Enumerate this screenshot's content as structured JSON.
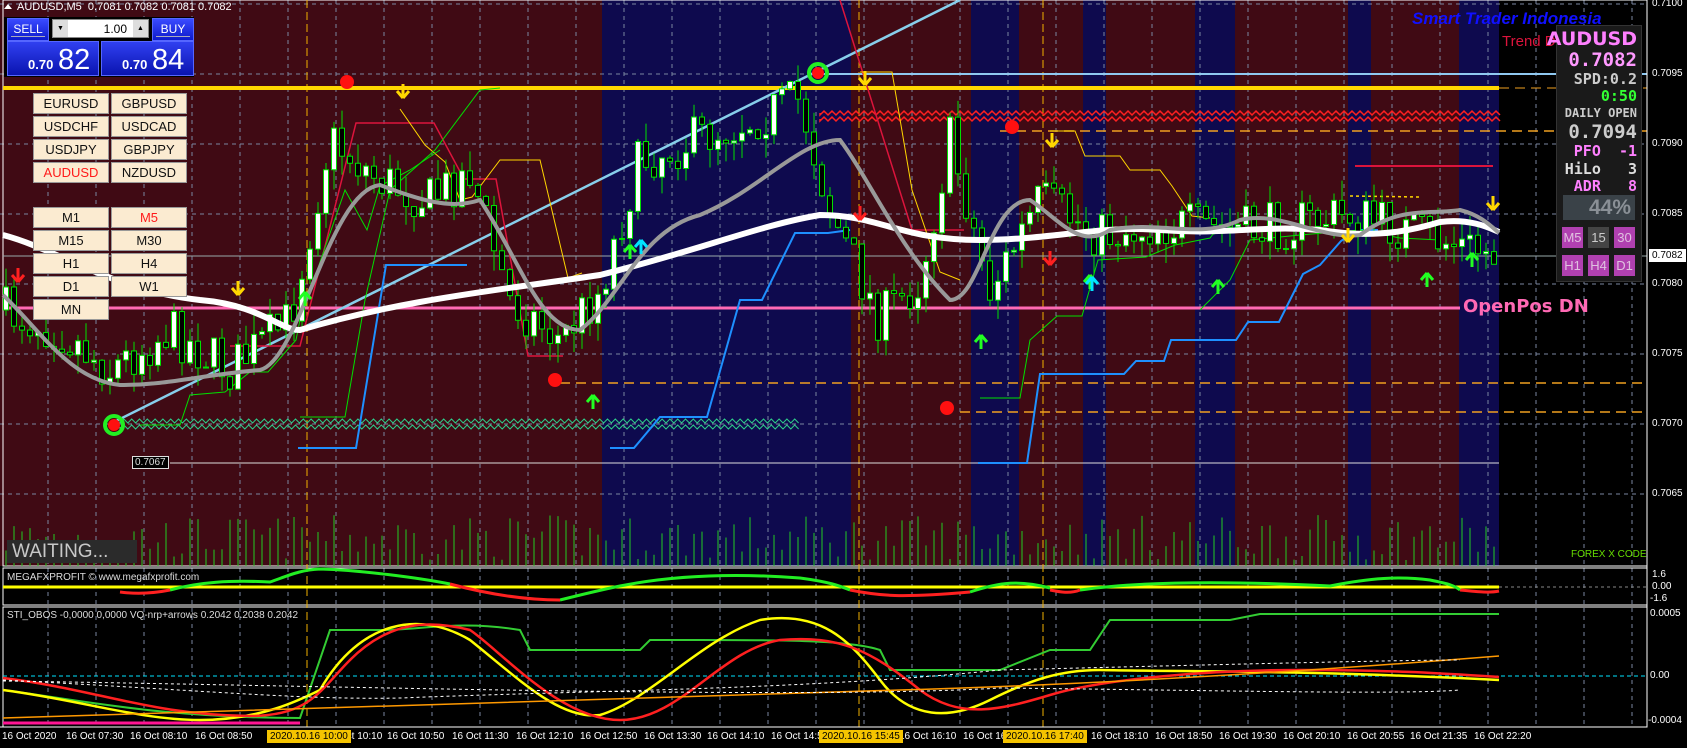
{
  "window": {
    "symbol_title": "AUDUSD,M5",
    "ohlc": "0.7081 0.7082 0.7081 0.7082"
  },
  "trade_panel": {
    "sell_label": "SELL",
    "buy_label": "BUY",
    "lot_size": "1.00",
    "sell_price_prefix": "0.70",
    "sell_price_big": "82",
    "buy_price_prefix": "0.70",
    "buy_price_big": "84"
  },
  "symbols": [
    {
      "label": "EURUSD",
      "selected": false
    },
    {
      "label": "GBPUSD",
      "selected": false
    },
    {
      "label": "USDCHF",
      "selected": false
    },
    {
      "label": "USDCAD",
      "selected": false
    },
    {
      "label": "USDJPY",
      "selected": false
    },
    {
      "label": "GBPJPY",
      "selected": false
    },
    {
      "label": "AUDUSD",
      "selected": true
    },
    {
      "label": "NZDUSD",
      "selected": false
    }
  ],
  "timeframes": [
    {
      "label": "M1",
      "selected": false
    },
    {
      "label": "M5",
      "selected": true
    },
    {
      "label": "M15",
      "selected": false
    },
    {
      "label": "M30",
      "selected": false
    },
    {
      "label": "H1",
      "selected": false
    },
    {
      "label": "H4",
      "selected": false
    },
    {
      "label": "D1",
      "selected": false
    },
    {
      "label": "W1",
      "selected": false
    },
    {
      "label": "MN",
      "selected": false
    }
  ],
  "status": {
    "waiting": "WAITING..."
  },
  "brand": {
    "name": "Smart Trader Indonesia",
    "trend": "Trend D"
  },
  "info_panel": {
    "symbol": "AUDUSD",
    "price": "0.7082",
    "spread": "SPD:0.2",
    "countdown": "0:50",
    "daily_open_label": "DAILY OPEN",
    "daily_open": "0.7094",
    "pfo_label": "PFO",
    "pfo": "-1",
    "hilo_label": "HiLo",
    "hilo": "3",
    "adr_label": "ADR",
    "adr": "8",
    "adr_percent": "44%",
    "tf_buttons": [
      "M5",
      "15",
      "30",
      "H1",
      "H4",
      "D1"
    ]
  },
  "annotations": {
    "open_pos": "OpenPos  DN",
    "forex_code": "FOREX X CODE",
    "level_label": "0.7067"
  },
  "price_axis": {
    "ticks": [
      "0.7100",
      "0.7095",
      "0.7090",
      "0.7085",
      "0.7080",
      "0.7075",
      "0.7070",
      "0.7065"
    ],
    "current": "0.7082"
  },
  "subwindow1": {
    "label": "MEGAFXPROFIT © www.megafxprofit.com",
    "ticks": [
      "1.6",
      "0.00",
      "-1.6"
    ]
  },
  "subwindow2": {
    "label": "STI_OBOS -0,0000 0,0000  VQ-nrp+arrows 0.2042 0.2038 0.2042",
    "ticks": [
      "0.0005",
      "0.00",
      "-0.0004"
    ]
  },
  "time_axis": {
    "labels": [
      "16 Oct 2020",
      "16 Oct 07:30",
      "16 Oct 08:10",
      "16 Oct 08:50",
      "16 Oct 10:10",
      "16 Oct 10:50",
      "16 Oct 11:30",
      "16 Oct 12:10",
      "16 Oct 12:50",
      "16 Oct 13:30",
      "16 Oct 14:10",
      "16 Oct 14:50",
      "16 Oct 16:10",
      "16 Oct 16:50",
      "16 Oct 18:10",
      "16 Oct 18:50",
      "16 Oct 19:30",
      "16 Oct 20:10",
      "16 Oct 20:55",
      "16 Oct 21:35",
      "16 Oct 22:20"
    ],
    "highlights": [
      "2020.10.16 10:00",
      "2020.10.16 15:45",
      "2020.10.16 17:40"
    ]
  },
  "colors": {
    "bull_zone": "#0e0a4e",
    "bear_zone": "#400a14",
    "candle_outline": "#00e000",
    "accent_yellow": "#ffd700",
    "open_pos": "#ff69b4"
  }
}
